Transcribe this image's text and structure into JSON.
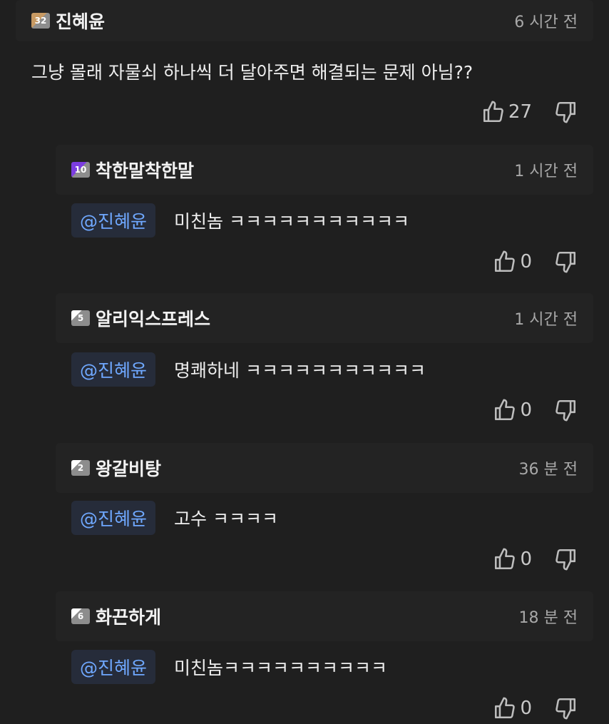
{
  "comment": {
    "username": "진혜윤",
    "level": "32",
    "time": "6 시간 전",
    "text": "그냥 몰래 자물쇠 하나씩 더 달아주면 해결되는 문제 아님??",
    "likes": "27"
  },
  "replies": [
    {
      "username": "착한말착한말",
      "level": "10",
      "time": "1 시간 전",
      "mention": "@진혜윤",
      "text": "미친놈 ㅋㅋㅋㅋㅋㅋㅋㅋㅋㅋㅋ",
      "likes": "0"
    },
    {
      "username": "알리익스프레스",
      "level": "5",
      "time": "1 시간 전",
      "mention": "@진혜윤",
      "text": "명쾌하네 ㅋㅋㅋㅋㅋㅋㅋㅋㅋㅋㅋ",
      "likes": "0"
    },
    {
      "username": "왕갈비탕",
      "level": "2",
      "time": "36 분 전",
      "mention": "@진혜윤",
      "text": "고수 ㅋㅋㅋㅋ",
      "likes": "0"
    },
    {
      "username": "화끈하게",
      "level": "6",
      "time": "18 분 전",
      "mention": "@진혜윤",
      "text": "미친놈ㅋㅋㅋㅋㅋㅋㅋㅋㅋㅋ",
      "likes": "0"
    }
  ],
  "colors": {
    "background": "#1f1f1f",
    "mention": "#6fa8ff",
    "mention_bg": "#262c3a"
  },
  "icons": {
    "like": "thumbs-up-icon",
    "dislike": "thumbs-down-icon"
  }
}
